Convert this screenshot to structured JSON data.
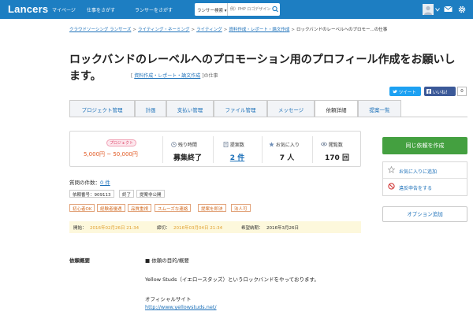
{
  "header": {
    "logo": "Lancers",
    "nav": [
      "マイページ",
      "仕事をさがす",
      "ランサーをさがす"
    ],
    "search": {
      "scope": "ランサー検索 ▾",
      "placeholder": "例）PHP ロゴデザイン"
    },
    "colors": {
      "bar": "#1d7ec2"
    }
  },
  "breadcrumb": {
    "items": [
      "クラウドソーシング ランサーズ",
      "ライティング・ネーミング",
      "ライティング",
      "資料作成・レポート・論文作成"
    ],
    "separator": ">",
    "current": "ロックバンドのレーベルへのプロモー...の仕事"
  },
  "title": {
    "text": "ロックバンドのレーベルへのプロモーション用のプロフィール作成をお願いします。",
    "category_open": "[",
    "category": "資料作成・レポート・論文作成",
    "category_close": "]",
    "category_suffix": "の仕事"
  },
  "social": {
    "tweet": "ツイート",
    "like": "いいね！",
    "like_count": "0"
  },
  "tabs": [
    {
      "label": "プロジェクト管理",
      "active": false
    },
    {
      "label": "計画",
      "active": false
    },
    {
      "label": "支払い管理",
      "active": false
    },
    {
      "label": "ファイル管理",
      "active": false
    },
    {
      "label": "メッセージ",
      "active": false
    },
    {
      "label": "依頼詳細",
      "active": true
    },
    {
      "label": "提案一覧",
      "active": false
    }
  ],
  "stats": {
    "type_badge": "プロジェクト",
    "budget": "5,000円 ~ 50,000円",
    "remaining": {
      "label": "残り時間",
      "value": "募集終了"
    },
    "proposals": {
      "label": "提案数",
      "value": "2 件"
    },
    "favorites": {
      "label": "お気に入り",
      "value": "7 人"
    },
    "views": {
      "label": "閲覧数",
      "value": "170 回"
    }
  },
  "sidebar": {
    "same_request": "同じ依頼を作成",
    "favorite": "お気に入りに追加",
    "report": "違反申告をする",
    "option": "オプション追加"
  },
  "questions": {
    "label": "質問の件数：",
    "count": "0 件"
  },
  "meta_tags": [
    "依頼番号：909113",
    "終了",
    "提案非公開"
  ],
  "feature_tags": [
    "初心者OK",
    "経験者優遇",
    "品質重視",
    "スムーズな連絡",
    "提案を即決",
    "法人可"
  ],
  "dates": {
    "start_label": "開始：",
    "start": "2016年02月26日 21:34",
    "end_label": "締切：",
    "end": "2016年03月04日 21:34",
    "delivery_label": "希望納期：",
    "delivery": "2016年3月26日"
  },
  "description": {
    "heading": "依頼概要",
    "subheading": "■ 依頼の目的/概要",
    "line1": "Yellow Studs（イエロースタッズ）というロックバンドをやっております。",
    "line2": "オフィシャルサイト",
    "url": "http://www.yellowstuds.net/"
  }
}
